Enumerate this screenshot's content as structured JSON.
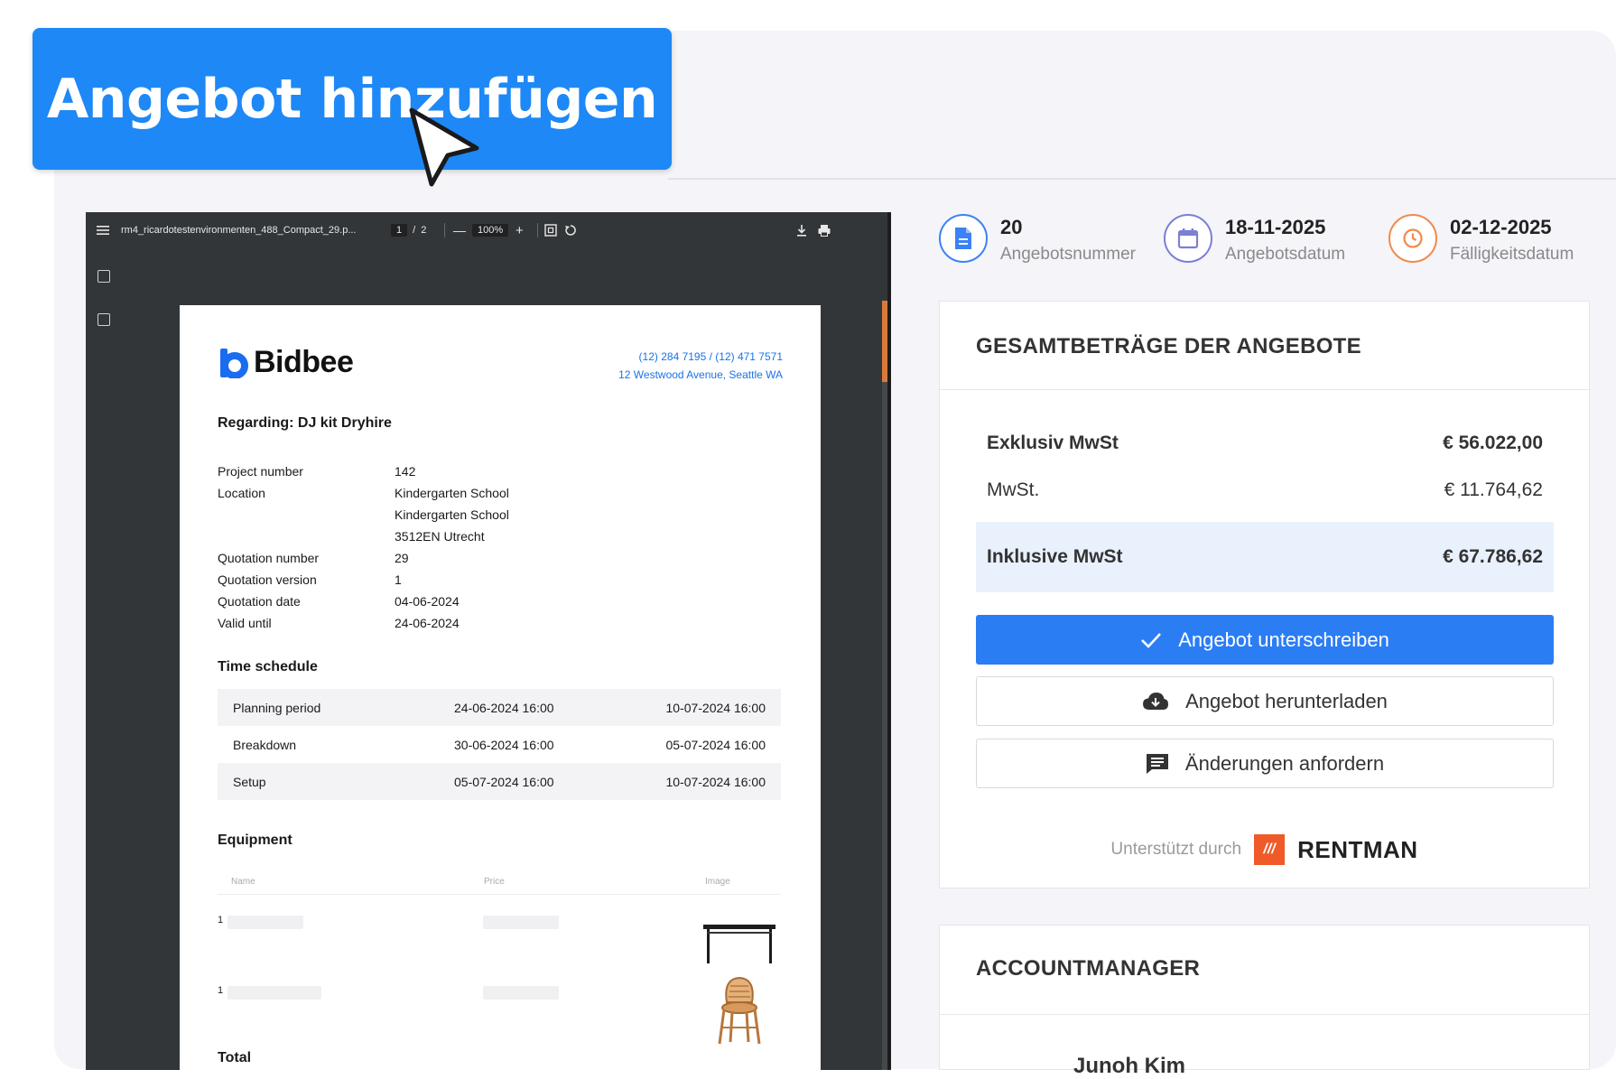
{
  "cta": {
    "label": "Angebot hinzufügen"
  },
  "pdf_viewer": {
    "filename": "rm4_ricardotestenvironmenten_488_Compact_29.p...",
    "page_current": "1",
    "page_sep": "/",
    "page_total": "2",
    "zoom": "100%",
    "zoom_out": "—",
    "zoom_in": "+"
  },
  "document": {
    "brand": "Bidbee",
    "phone": "(12) 284 7195 / (12) 471 7571",
    "address": "12 Westwood Avenue, Seattle WA",
    "regarding": "Regarding: DJ kit Dryhire",
    "details": [
      {
        "key": "Project number",
        "value": "142"
      },
      {
        "key": "Location",
        "value": "Kindergarten School"
      },
      {
        "key": "",
        "value": "Kindergarten School"
      },
      {
        "key": "",
        "value": "3512EN Utrecht"
      },
      {
        "key": "Quotation number",
        "value": "29"
      },
      {
        "key": "Quotation version",
        "value": "1"
      },
      {
        "key": "Quotation date",
        "value": "04-06-2024"
      },
      {
        "key": "Valid until",
        "value": "24-06-2024"
      }
    ],
    "time_schedule_title": "Time schedule",
    "schedule": [
      {
        "name": "Planning period",
        "start": "24-06-2024 16:00",
        "end": "10-07-2024 16:00"
      },
      {
        "name": "Breakdown",
        "start": "30-06-2024 16:00",
        "end": "05-07-2024 16:00"
      },
      {
        "name": "Setup",
        "start": "05-07-2024 16:00",
        "end": "10-07-2024 16:00"
      }
    ],
    "equipment_title": "Equipment",
    "equipment_columns": {
      "name": "Name",
      "price": "Price",
      "image": "Image"
    },
    "equipment_rows": [
      {
        "qty": "1"
      },
      {
        "qty": "1"
      }
    ],
    "total_title": "Total"
  },
  "quote_info": [
    {
      "value": "20",
      "label": "Angebotsnummer",
      "icon": "document-icon",
      "color": "#3b82f6"
    },
    {
      "value": "18-11-2025",
      "label": "Angebotsdatum",
      "icon": "calendar-icon",
      "color": "#7c7fd6"
    },
    {
      "value": "02-12-2025",
      "label": "Fälligkeitsdatum",
      "icon": "clock-icon",
      "color": "#f08a4b"
    }
  ],
  "totals": {
    "title": "GESAMTBETRÄGE DER ANGEBOTE",
    "rows": [
      {
        "label": "Exklusiv MwSt",
        "value": "€ 56.022,00"
      },
      {
        "label": "MwSt.",
        "value": "€ 11.764,62"
      },
      {
        "label": "Inklusive MwSt",
        "value": "€ 67.786,62"
      }
    ],
    "sign_label": "Angebot unterschreiben",
    "download_label": "Angebot herunterladen",
    "changes_label": "Änderungen anfordern",
    "powered_by": "Unterstützt durch",
    "powered_brand": "RENTMAN"
  },
  "account_manager": {
    "title": "ACCOUNTMANAGER",
    "name": "Junoh Kim"
  },
  "colors": {
    "primary": "#2b7df4",
    "cta": "#1e88f6",
    "highlight": "#e9f1fd",
    "rentman": "#ef5a28"
  }
}
